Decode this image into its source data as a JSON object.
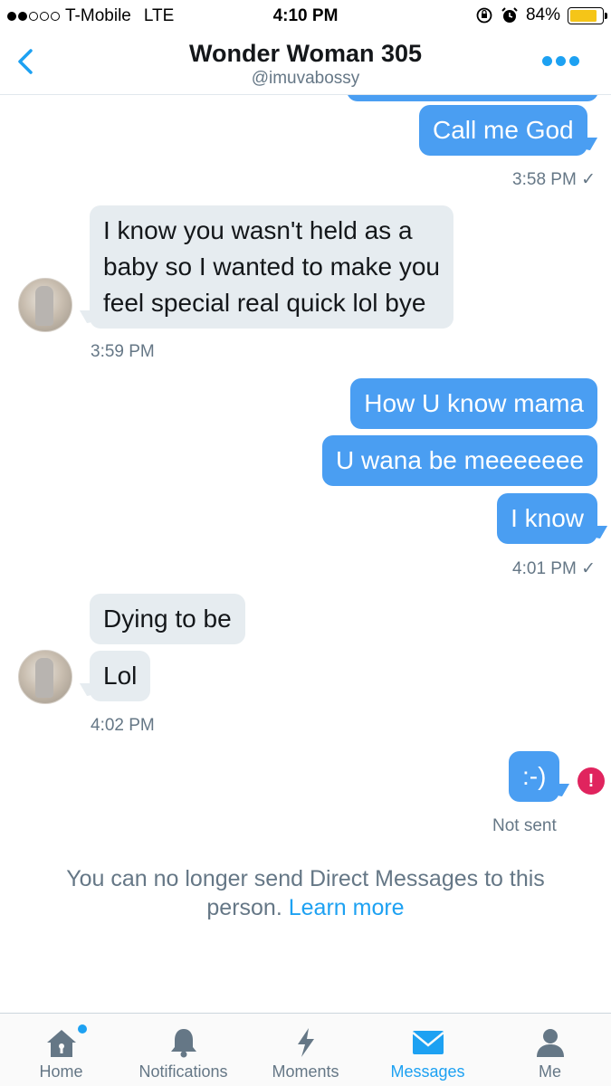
{
  "status_bar": {
    "carrier": "T-Mobile",
    "network": "LTE",
    "time": "4:10 PM",
    "battery": "84%",
    "battery_level": 0.84
  },
  "header": {
    "title": "Wonder Woman 305",
    "handle": "@imuvabossy",
    "back_icon": "chevron-left-icon",
    "more_icon": "more-dots-icon"
  },
  "messages": [
    {
      "from": "me",
      "text": "Call me God"
    },
    {
      "from": "me",
      "meta": "3:58 PM ✓"
    },
    {
      "from": "them",
      "text": "I know you wasn't held as a baby so I wanted to make you feel special real quick lol bye"
    },
    {
      "from": "them",
      "meta": "3:59 PM"
    },
    {
      "from": "me",
      "text": "How U know mama"
    },
    {
      "from": "me",
      "text": "U wana be meeeeeee"
    },
    {
      "from": "me",
      "text": "I know"
    },
    {
      "from": "me",
      "meta": "4:01 PM ✓"
    },
    {
      "from": "them",
      "text": "Dying to be"
    },
    {
      "from": "them",
      "text": "Lol"
    },
    {
      "from": "them",
      "meta": "4:02 PM"
    },
    {
      "from": "me",
      "text": ":-)"
    },
    {
      "from": "me",
      "meta": "Not sent"
    }
  ],
  "lines": {
    "line1": "I know you wasn't held as a",
    "line2": "baby so I wanted to make you",
    "line3": "feel special real quick lol bye"
  },
  "notice": {
    "text": "You can no longer send Direct Messages to this person.",
    "link": "Learn more"
  },
  "tabs": [
    {
      "label": "Home",
      "icon": "home-icon"
    },
    {
      "label": "Notifications",
      "icon": "bell-icon"
    },
    {
      "label": "Moments",
      "icon": "lightning-icon"
    },
    {
      "label": "Messages",
      "icon": "envelope-icon",
      "active": true
    },
    {
      "label": "Me",
      "icon": "person-icon"
    }
  ],
  "colors": {
    "accent": "#1da1f2",
    "outgoing_bubble": "#4a9ef2",
    "incoming_bubble": "#e6ecf0",
    "error": "#e0245e"
  }
}
